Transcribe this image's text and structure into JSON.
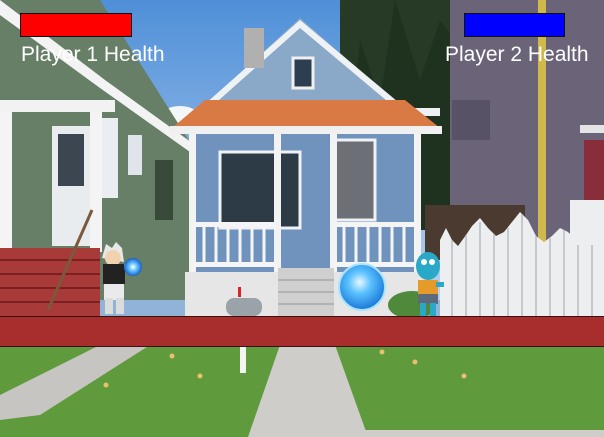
{
  "hud": {
    "player1": {
      "label": "Player 1 Health",
      "health_fraction": 1.0,
      "bar_color": "#ff0000"
    },
    "player2": {
      "label": "Player 2 Health",
      "health_fraction": 1.0,
      "bar_color": "#0000ff"
    }
  },
  "colors": {
    "platform": "#a82e2e",
    "projectile": "#2aa6ff"
  }
}
